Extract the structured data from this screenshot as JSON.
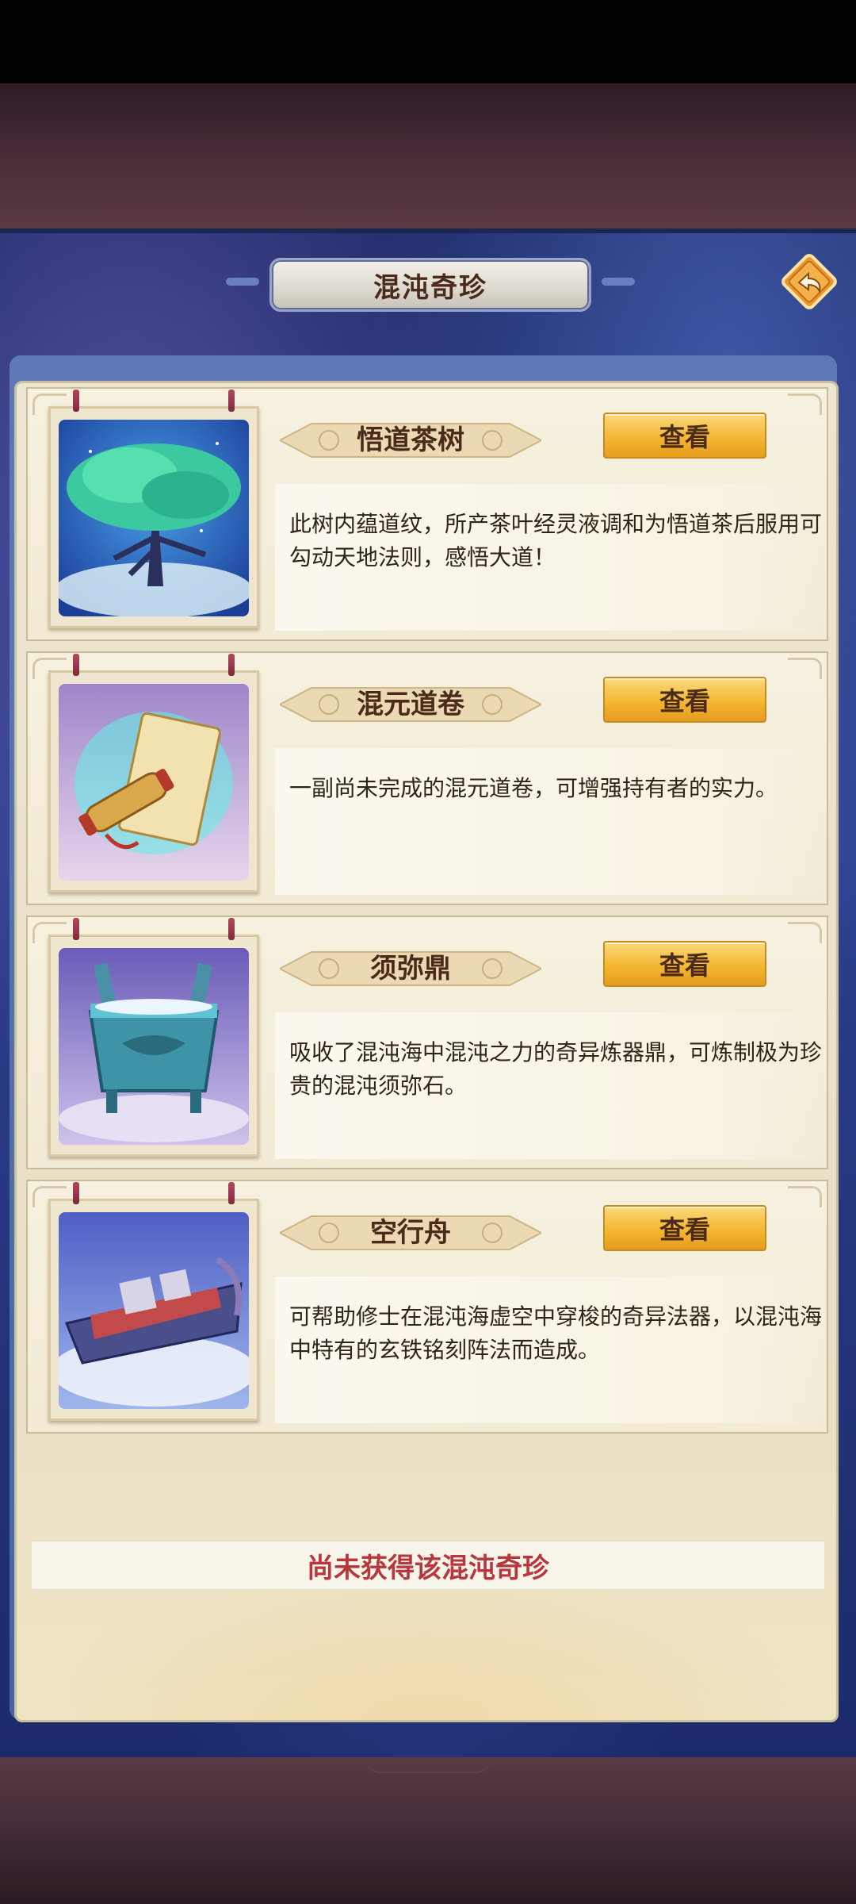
{
  "header": {
    "title": "混沌奇珍"
  },
  "items": [
    {
      "name": "悟道茶树",
      "button": "查看",
      "desc": "此树内蕴道纹，所产茶叶经灵液调和为悟道茶后服用可勾动天地法则，感悟大道！"
    },
    {
      "name": "混元道卷",
      "button": "查看",
      "desc": "一副尚未完成的混元道卷，可增强持有者的实力。"
    },
    {
      "name": "须弥鼎",
      "button": "查看",
      "desc": "吸收了混沌海中混沌之力的奇异炼器鼎，可炼制极为珍贵的混沌须弥石。"
    },
    {
      "name": "空行舟",
      "button": "查看",
      "desc": "可帮助修士在混沌海虚空中穿梭的奇异法器，以混沌海中特有的玄铁铭刻阵法而造成。"
    }
  ],
  "notice": "尚未获得该混沌奇珍",
  "icons": {
    "back": "back-arrow-icon"
  },
  "colors": {
    "accent_gold": "#f4b733",
    "notice_red": "#b8363c",
    "title_brown": "#4a2b1a"
  }
}
